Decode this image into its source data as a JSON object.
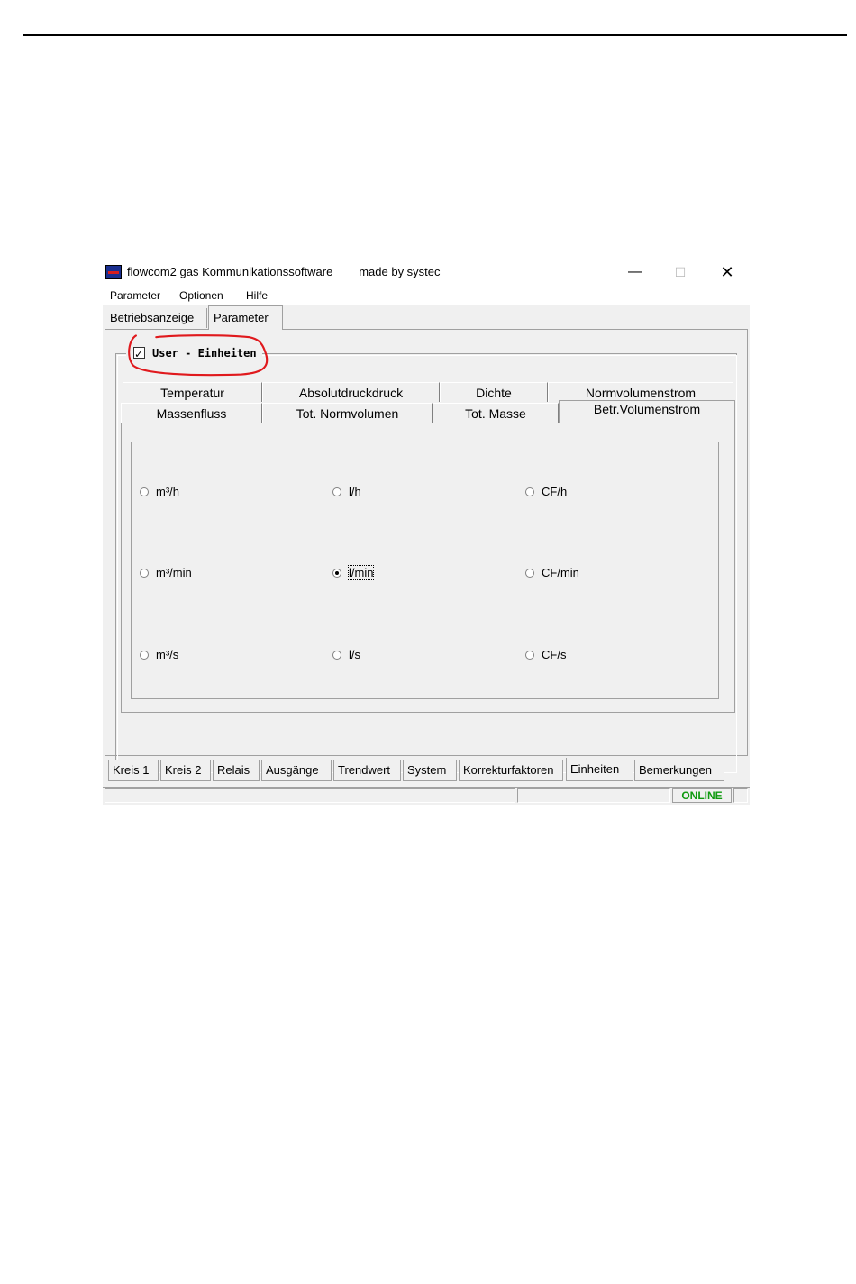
{
  "window": {
    "title": "flowcom2 gas Kommunikationssoftware        made by systec",
    "controls": {
      "minimize": "—",
      "maximize": "☐",
      "close": "✕"
    }
  },
  "menu": [
    "Parameter",
    "Optionen",
    "Hilfe"
  ],
  "outer_tabs": [
    {
      "label": "Betriebsanzeige",
      "active": false
    },
    {
      "label": "Parameter",
      "active": true
    }
  ],
  "user_units": {
    "label": "User - Einheiten",
    "checked": true,
    "highlight_color": "#e0191d"
  },
  "inner_tabs_row1": [
    "Temperatur",
    "Absolutdruckdruck",
    "Dichte",
    "Normvolumenstrom"
  ],
  "inner_tabs_row2": [
    "Massenfluss",
    "Tot. Normvolumen",
    "Tot. Masse",
    "Betr.Volumenstrom"
  ],
  "active_inner_tab": "Betr.Volumenstrom",
  "units": [
    [
      "m³/h",
      "l/h",
      "CF/h"
    ],
    [
      "m³/min",
      "l/min",
      "CF/min"
    ],
    [
      "m³/s",
      "l/s",
      "CF/s"
    ]
  ],
  "selected_unit": "l/min",
  "bottom_tabs": [
    "Kreis 1",
    "Kreis 2",
    "Relais",
    "Ausgänge",
    "Trendwert",
    "System",
    "Korrekturfaktoren",
    "Einheiten",
    "Bemerkungen"
  ],
  "active_bottom_tab": "Einheiten",
  "status": {
    "connection": "ONLINE",
    "connection_color": "#109a10"
  }
}
